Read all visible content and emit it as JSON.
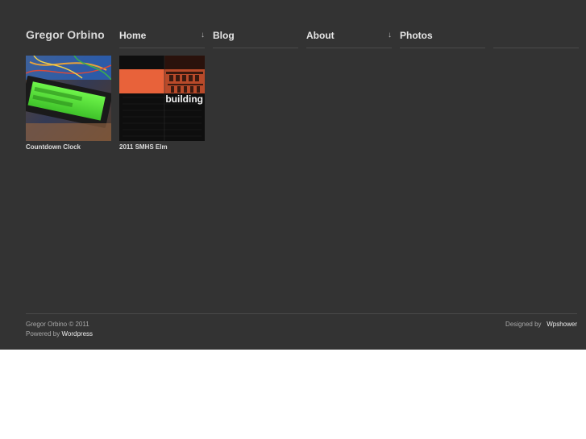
{
  "site": {
    "logo": "Gregor Orbino"
  },
  "nav": [
    {
      "label": "Home",
      "has_dropdown": true
    },
    {
      "label": "Blog",
      "has_dropdown": false
    },
    {
      "label": "About",
      "has_dropdown": true
    },
    {
      "label": "Photos",
      "has_dropdown": false
    },
    {
      "label": "",
      "has_dropdown": false
    }
  ],
  "nav_arrow": "↓",
  "posts": [
    {
      "title": "Countdown Clock",
      "image": "lcd-circuit-photo"
    },
    {
      "title": "2011 SMHS Elm",
      "image": "yearbook-cover",
      "cover_word": "building"
    }
  ],
  "footer": {
    "copyright": "Gregor Orbino © 2011",
    "powered_prefix": "Powered by",
    "powered_link": "Wordpress",
    "designed_prefix": "Designed by",
    "designed_link": "Wpshower"
  },
  "colors": {
    "background": "#333333",
    "accent_orange": "#e8623a",
    "lcd_green": "#59e63a"
  }
}
